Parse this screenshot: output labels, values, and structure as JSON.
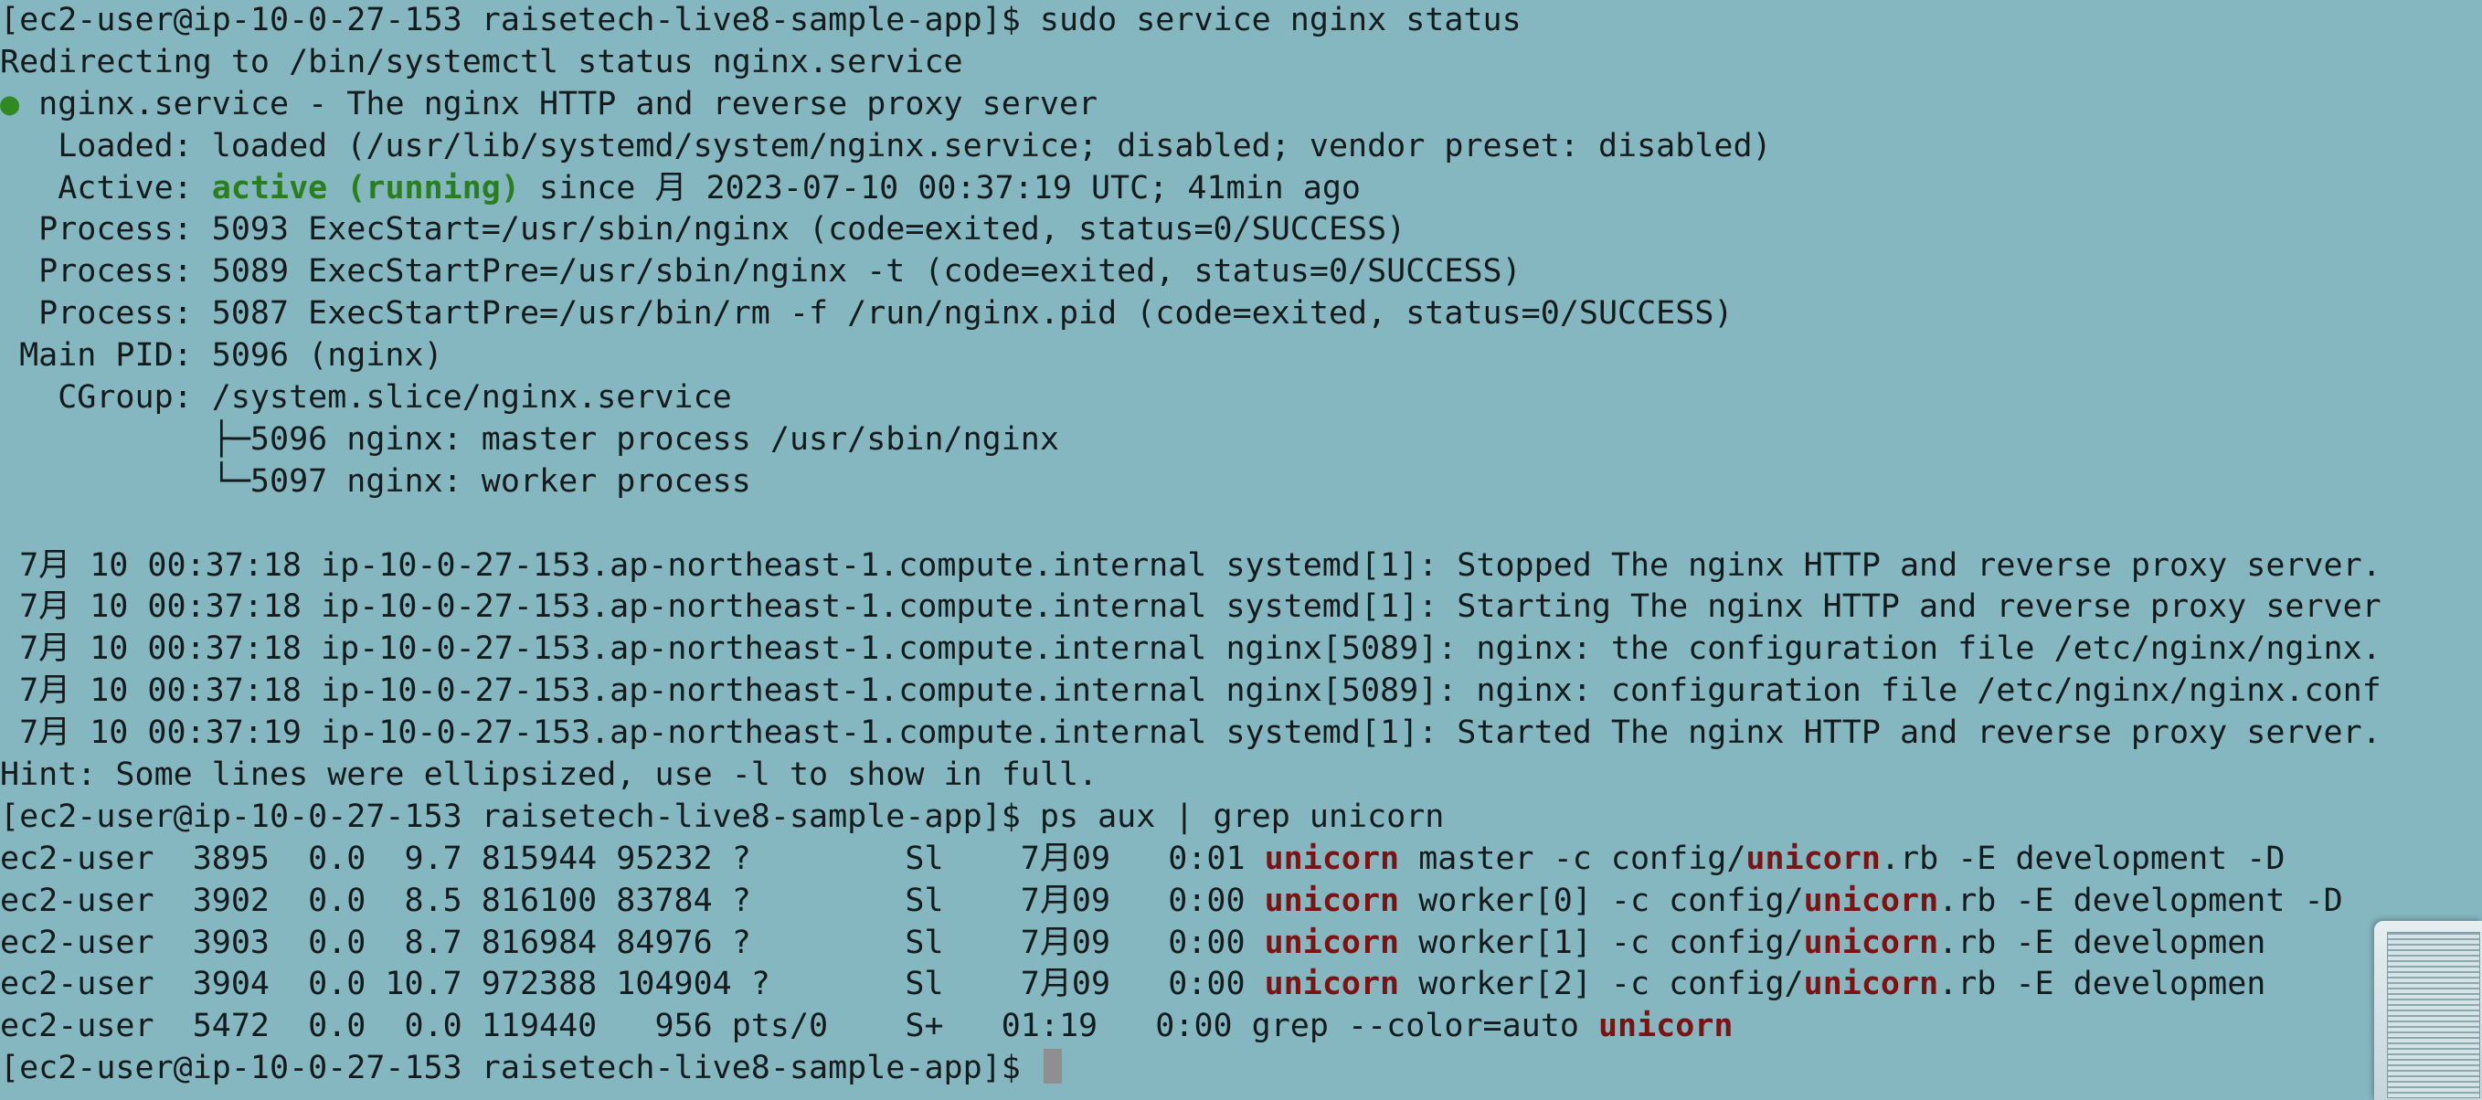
{
  "terminal": {
    "background": "#84b7bf",
    "lines": [
      {
        "segments": [
          {
            "t": "[ec2-user@ip-10-0-27-153 raisetech-live8-sample-app]$ sudo service nginx status"
          }
        ]
      },
      {
        "segments": [
          {
            "t": "Redirecting to /bin/systemctl status nginx.service"
          }
        ]
      },
      {
        "segments": [
          {
            "t": "●",
            "c": "dot"
          },
          {
            "t": " nginx.service - The nginx HTTP and reverse proxy server"
          }
        ]
      },
      {
        "segments": [
          {
            "t": "   Loaded: loaded (/usr/lib/systemd/system/nginx.service; disabled; vendor preset: disabled)"
          }
        ]
      },
      {
        "segments": [
          {
            "t": "   Active: "
          },
          {
            "t": "active (running)",
            "c": "green"
          },
          {
            "t": " since 月 2023-07-10 00:37:19 UTC; 41min ago"
          }
        ]
      },
      {
        "segments": [
          {
            "t": "  Process: 5093 ExecStart=/usr/sbin/nginx (code=exited, status=0/SUCCESS)"
          }
        ]
      },
      {
        "segments": [
          {
            "t": "  Process: 5089 ExecStartPre=/usr/sbin/nginx -t (code=exited, status=0/SUCCESS)"
          }
        ]
      },
      {
        "segments": [
          {
            "t": "  Process: 5087 ExecStartPre=/usr/bin/rm -f /run/nginx.pid (code=exited, status=0/SUCCESS)"
          }
        ]
      },
      {
        "segments": [
          {
            "t": " Main PID: 5096 (nginx)"
          }
        ]
      },
      {
        "segments": [
          {
            "t": "   CGroup: /system.slice/nginx.service"
          }
        ]
      },
      {
        "segments": [
          {
            "t": "           ├─5096 nginx: master process /usr/sbin/nginx"
          }
        ]
      },
      {
        "segments": [
          {
            "t": "           └─5097 nginx: worker process"
          }
        ]
      },
      {
        "segments": [
          {
            "t": ""
          }
        ]
      },
      {
        "segments": [
          {
            "t": " 7月 10 00:37:18 ip-10-0-27-153.ap-northeast-1.compute.internal systemd[1]: Stopped The nginx HTTP and reverse proxy server."
          }
        ]
      },
      {
        "segments": [
          {
            "t": " 7月 10 00:37:18 ip-10-0-27-153.ap-northeast-1.compute.internal systemd[1]: Starting The nginx HTTP and reverse proxy server"
          }
        ]
      },
      {
        "segments": [
          {
            "t": " 7月 10 00:37:18 ip-10-0-27-153.ap-northeast-1.compute.internal nginx[5089]: nginx: the configuration file /etc/nginx/nginx."
          }
        ]
      },
      {
        "segments": [
          {
            "t": " 7月 10 00:37:18 ip-10-0-27-153.ap-northeast-1.compute.internal nginx[5089]: nginx: configuration file /etc/nginx/nginx.conf"
          }
        ]
      },
      {
        "segments": [
          {
            "t": " 7月 10 00:37:19 ip-10-0-27-153.ap-northeast-1.compute.internal systemd[1]: Started The nginx HTTP and reverse proxy server."
          }
        ]
      },
      {
        "segments": [
          {
            "t": "Hint: Some lines were ellipsized, use -l to show in full."
          }
        ]
      },
      {
        "segments": [
          {
            "t": "[ec2-user@ip-10-0-27-153 raisetech-live8-sample-app]$ ps aux | grep unicorn"
          }
        ]
      },
      {
        "segments": [
          {
            "t": "ec2-user  3895  0.0  9.7 815944 95232 ?        Sl    7月09   0:01 "
          },
          {
            "t": "unicorn",
            "c": "match"
          },
          {
            "t": " master -c config/"
          },
          {
            "t": "unicorn",
            "c": "match"
          },
          {
            "t": ".rb -E development -D"
          }
        ]
      },
      {
        "segments": [
          {
            "t": "ec2-user  3902  0.0  8.5 816100 83784 ?        Sl    7月09   0:00 "
          },
          {
            "t": "unicorn",
            "c": "match"
          },
          {
            "t": " worker[0] -c config/"
          },
          {
            "t": "unicorn",
            "c": "match"
          },
          {
            "t": ".rb -E development -D"
          }
        ]
      },
      {
        "segments": [
          {
            "t": "ec2-user  3903  0.0  8.7 816984 84976 ?        Sl    7月09   0:00 "
          },
          {
            "t": "unicorn",
            "c": "match"
          },
          {
            "t": " worker[1] -c config/"
          },
          {
            "t": "unicorn",
            "c": "match"
          },
          {
            "t": ".rb -E developmen"
          }
        ]
      },
      {
        "segments": [
          {
            "t": "ec2-user  3904  0.0 10.7 972388 104904 ?       Sl    7月09   0:00 "
          },
          {
            "t": "unicorn",
            "c": "match"
          },
          {
            "t": " worker[2] -c config/"
          },
          {
            "t": "unicorn",
            "c": "match"
          },
          {
            "t": ".rb -E developmen"
          }
        ]
      },
      {
        "segments": [
          {
            "t": "ec2-user  5472  0.0  0.0 119440   956 pts/0    S+   01:19   0:00 grep --color=auto "
          },
          {
            "t": "unicorn",
            "c": "match"
          }
        ]
      },
      {
        "segments": [
          {
            "t": "[ec2-user@ip-10-0-27-153 raisetech-live8-sample-app]$ "
          }
        ],
        "cursor": true
      }
    ]
  },
  "thumbnail": {
    "icon": "screenshot-thumbnail-icon"
  }
}
